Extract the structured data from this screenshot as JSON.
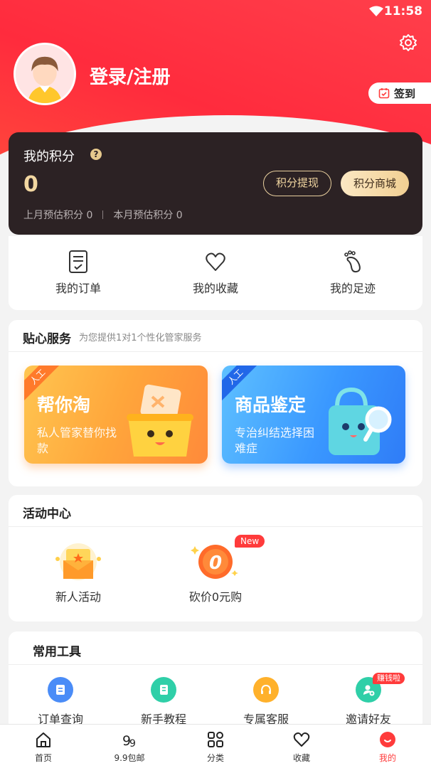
{
  "status_bar": {
    "time": "11:58"
  },
  "profile": {
    "login_label": "登录/注册",
    "signin_label": "签到"
  },
  "points": {
    "title": "我的积分",
    "help": "?",
    "value": "0",
    "last_month": "上月预估积分 0",
    "this_month": "本月预估积分 0",
    "withdraw_label": "积分提现",
    "mall_label": "积分商城"
  },
  "quick_links": [
    {
      "label": "我的订单",
      "icon": "order-list-icon"
    },
    {
      "label": "我的收藏",
      "icon": "heart-icon"
    },
    {
      "label": "我的足迹",
      "icon": "footprint-icon"
    }
  ],
  "service": {
    "title": "贴心服务",
    "subtitle": "为您提供1对1个性化管家服务",
    "cards": [
      {
        "tag": "人工",
        "title": "帮你淘",
        "desc": "私人管家替你找款"
      },
      {
        "tag": "人工",
        "title": "商品鉴定",
        "desc": "专治纠结选择困难症"
      }
    ]
  },
  "activity": {
    "title": "活动中心",
    "items": [
      {
        "label": "新人活动",
        "icon": "gift-envelope-icon"
      },
      {
        "label": "砍价0元购",
        "icon": "bargain-zero-icon",
        "badge": "New"
      }
    ]
  },
  "tools": {
    "title": "常用工具",
    "items": [
      {
        "label": "订单查询",
        "icon": "order-query-icon",
        "color": "#4a8cf7"
      },
      {
        "label": "新手教程",
        "icon": "tutorial-icon",
        "color": "#2fcfa8"
      },
      {
        "label": "专属客服",
        "icon": "headset-icon",
        "color": "#ffb12b"
      },
      {
        "label": "邀请好友",
        "icon": "invite-friend-icon",
        "color": "#2fcfa8",
        "badge": "赚钱啦"
      }
    ]
  },
  "tabbar": [
    {
      "label": "首页",
      "icon": "home-icon"
    },
    {
      "label": "9.9包邮",
      "icon": "nine-nine-icon"
    },
    {
      "label": "分类",
      "icon": "category-icon"
    },
    {
      "label": "收藏",
      "icon": "heart-icon"
    },
    {
      "label": "我的",
      "icon": "profile-icon",
      "active": true
    }
  ],
  "colors": {
    "brand": "#ff3b3b",
    "gold": "#f2d7a1",
    "dark_card": "#2c2224"
  }
}
